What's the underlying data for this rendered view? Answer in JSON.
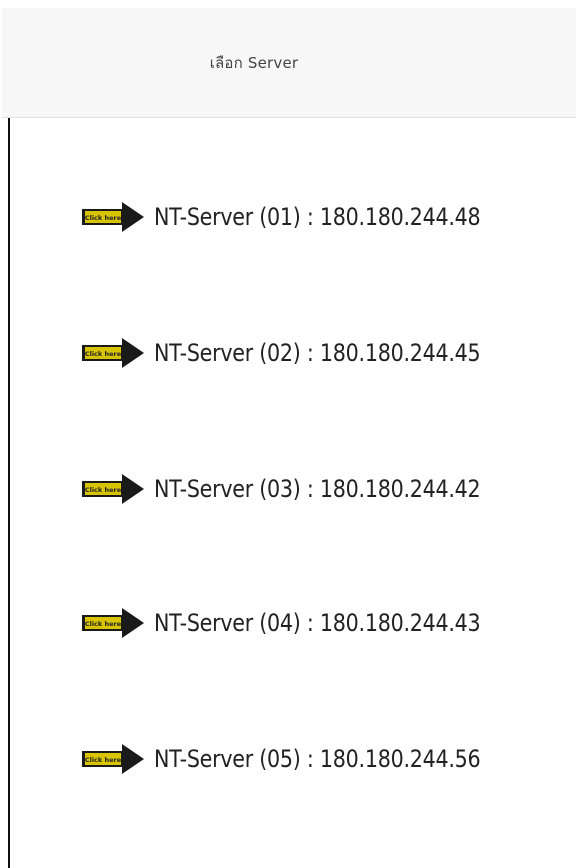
{
  "modal": {
    "title": "เลือก Server"
  },
  "servers": [
    {
      "label": "NT-Server (01) : 180.180.244.48",
      "icon": "click-here-arrow-icon",
      "icon_text": "Click here"
    },
    {
      "label": "NT-Server (02) : 180.180.244.45",
      "icon": "click-here-arrow-icon",
      "icon_text": "Click here"
    },
    {
      "label": "NT-Server (03) : 180.180.244.42",
      "icon": "click-here-arrow-icon",
      "icon_text": "Click here"
    },
    {
      "label": "NT-Server (04) : 180.180.244.43",
      "icon": "click-here-arrow-icon",
      "icon_text": "Click here"
    },
    {
      "label": "NT-Server (05) : 180.180.244.56",
      "icon": "click-here-arrow-icon",
      "icon_text": "Click here"
    }
  ],
  "colors": {
    "arrow_fill": "#1a1a1a",
    "arrow_label_bg": "#d8c400",
    "header_bg": "#f7f7f7"
  }
}
